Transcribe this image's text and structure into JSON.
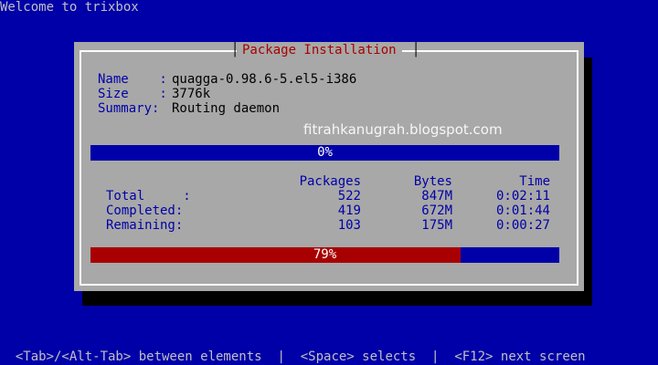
{
  "window_title": "Welcome to trixbox",
  "watermark": "fitrahkanugrah.blogspot.com",
  "dialog": {
    "title": "Package Installation",
    "name_label": "Name    :",
    "name_value": "quagga-0.98.6-5.el5-i386",
    "size_label": "Size    :",
    "size_value": "3776k",
    "summary_label": "Summary:",
    "summary_value": "Routing daemon",
    "package_progress": {
      "label": "0%",
      "fraction": 0.0
    },
    "table": {
      "headers": [
        "Packages",
        "Bytes",
        "Time"
      ],
      "rows": [
        {
          "label": "Total     :",
          "packages": "522",
          "bytes": "847M",
          "time": "0:02:11"
        },
        {
          "label": "Completed:",
          "packages": "419",
          "bytes": "672M",
          "time": "0:01:44"
        },
        {
          "label": "Remaining:",
          "packages": "103",
          "bytes": "175M",
          "time": "0:00:27"
        }
      ]
    },
    "total_progress": {
      "label": "79%",
      "fraction": 0.79
    }
  },
  "footer": {
    "items": [
      "  <Tab>/<Alt-Tab> between elements  ",
      "|",
      "  <Space> selects  ",
      "|",
      "  <F12> next screen"
    ]
  },
  "colors": {
    "background": "#0000a8",
    "dialog": "#a8a8a8",
    "title": "#a80000",
    "progress_fill": "#a80000",
    "progress_track": "#0000a8"
  }
}
